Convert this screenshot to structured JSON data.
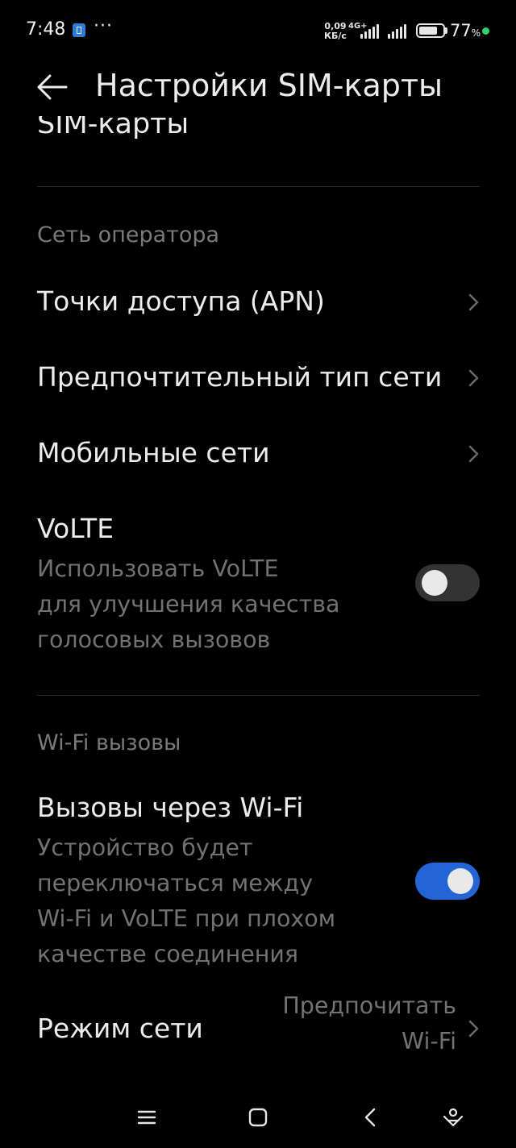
{
  "status_bar": {
    "time": "7:48",
    "dots": "···",
    "speed_value": "0,09",
    "speed_unit": "КБ/с",
    "network_type": "4G+",
    "battery_percent": "77",
    "battery_unit": "%",
    "battery_level": 0.77
  },
  "header": {
    "title": "Настройки SIM-карты",
    "clipped_text": "SIM-карты"
  },
  "sections": {
    "operator_network": {
      "header": "Сеть оператора",
      "apn_label": "Точки доступа (APN)",
      "preferred_network_label": "Предпочтительный тип сети",
      "mobile_networks_label": "Мобильные сети",
      "volte": {
        "title": "VoLTE",
        "desc_line1": "Использовать VoLTE",
        "desc_line2": "для улучшения качества",
        "desc_line3": "голосовых вызовов",
        "enabled": false
      }
    },
    "wifi_calling": {
      "header": "Wi-Fi вызовы",
      "title": "Вызовы через Wi-Fi",
      "desc_line1": "Устройство будет",
      "desc_line2": "переключаться между",
      "desc_line3": "Wi-Fi и VoLTE при плохом",
      "desc_line4": "качестве соединения",
      "enabled": true,
      "network_mode": {
        "label": "Режим сети",
        "value_line1": "Предпочитать",
        "value_line2": "Wi-Fi"
      }
    }
  },
  "nav_bar": {
    "icons": [
      "menu-icon",
      "home-icon",
      "back-icon",
      "assistant-icon"
    ]
  },
  "colors": {
    "background": "#000000",
    "accent": "#2365d6",
    "primary_text": "#ececec",
    "secondary_text": "#727272",
    "battery_dot": "#2fd06a"
  }
}
